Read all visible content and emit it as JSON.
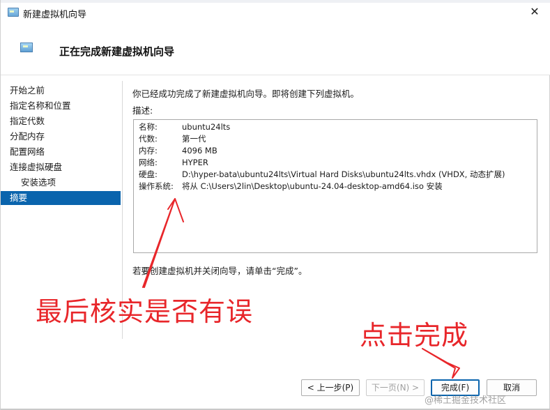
{
  "window": {
    "title": "新建虚拟机向导",
    "close_glyph": "✕"
  },
  "header": {
    "title": "正在完成新建虚拟机向导"
  },
  "sidebar": {
    "items": [
      {
        "label": "开始之前",
        "active": false
      },
      {
        "label": "指定名称和位置",
        "active": false
      },
      {
        "label": "指定代数",
        "active": false
      },
      {
        "label": "分配内存",
        "active": false
      },
      {
        "label": "配置网络",
        "active": false
      },
      {
        "label": "连接虚拟硬盘",
        "active": false
      },
      {
        "label": "安装选项",
        "active": false,
        "sub": true
      },
      {
        "label": "摘要",
        "active": true
      }
    ]
  },
  "main": {
    "intro": "你已经成功完成了新建虚拟机向导。即将创建下列虚拟机。",
    "desc_label": "描述:",
    "summary": [
      {
        "key": "名称:",
        "value": "ubuntu24lts"
      },
      {
        "key": "代数:",
        "value": "第一代"
      },
      {
        "key": "内存:",
        "value": "4096 MB"
      },
      {
        "key": "网络:",
        "value": "HYPER"
      },
      {
        "key": "硬盘:",
        "value": "D:\\hyper-bata\\ubuntu24lts\\Virtual Hard Disks\\ubuntu24lts.vhdx (VHDX, 动态扩展)"
      },
      {
        "key": "操作系统:",
        "value": "将从 C:\\Users\\2lin\\Desktop\\ubuntu-24.04-desktop-amd64.iso 安装"
      }
    ],
    "finish_note": "若要创建虚拟机并关闭向导，请单击“完成”。"
  },
  "annotations": {
    "check_text": "最后核实是否有误",
    "click_text": "点击完成",
    "color": "#e8262a"
  },
  "buttons": {
    "prev": "< 上一步(P)",
    "next": "下一页(N) >",
    "finish": "完成(F)",
    "cancel": "取消"
  },
  "watermark": "@稀土掘金技术社区",
  "colors": {
    "accent": "#0a64ad"
  }
}
